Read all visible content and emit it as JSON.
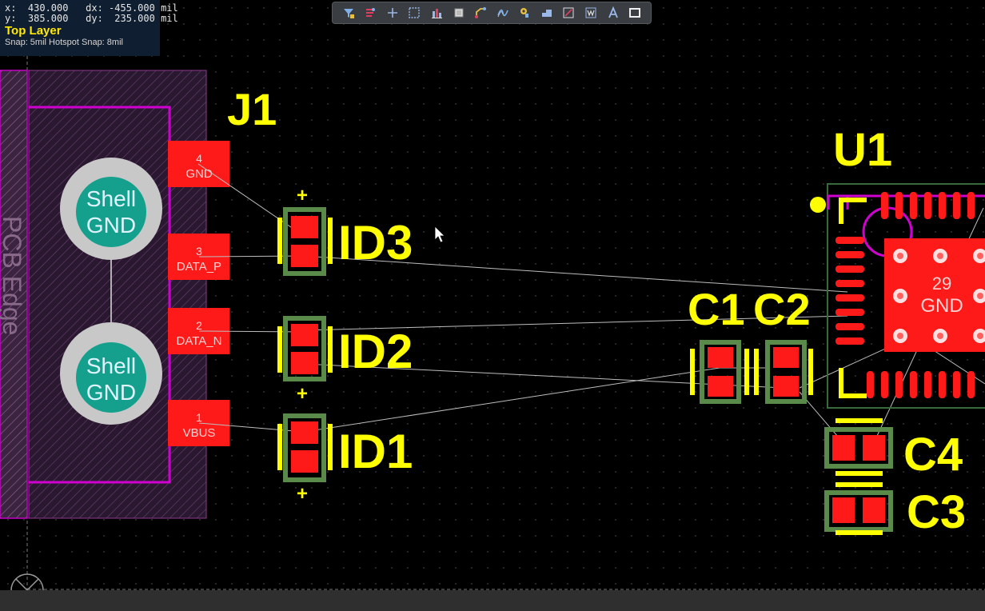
{
  "hud": {
    "line1": "x:  430.000   dx: -455.000 mil",
    "line2": "y:  385.000   dy:  235.000 mil",
    "layer": "Top Layer",
    "snap": "Snap: 5mil Hotspot Snap: 8mil"
  },
  "toolbar": {
    "tools": [
      "filter-icon",
      "route-icon",
      "crosshair-icon",
      "select-rect-icon",
      "align-icon",
      "component-icon",
      "interactive-route-icon",
      "diff-pair-icon",
      "via-icon",
      "polygon-icon",
      "dimension-icon",
      "string-icon",
      "text-icon",
      "rectangle-icon"
    ]
  },
  "board": {
    "edge_label": "PCB Edge",
    "j1": {
      "designator": "J1",
      "shell_top": [
        "Shell",
        "GND"
      ],
      "shell_bottom": [
        "Shell",
        "GND"
      ],
      "pads": [
        {
          "num": "4",
          "net": "GND"
        },
        {
          "num": "3",
          "net": "DATA_P"
        },
        {
          "num": "2",
          "net": "DATA_N"
        },
        {
          "num": "1",
          "net": "VBUS"
        }
      ]
    },
    "diodes": [
      "ID3",
      "ID2",
      "ID1"
    ],
    "caps": [
      "C1",
      "C2",
      "C4",
      "C3"
    ],
    "u1": {
      "designator": "U1",
      "pad_num": "29",
      "pad_net": "GND"
    }
  },
  "colors": {
    "background": "#000000",
    "pad_red": "#ff1a1a",
    "silk_yellow": "#ffff00",
    "outline_magenta": "#c800c8",
    "body_green": "#5a8a4a",
    "shell_teal": "#14a08c",
    "shell_gray": "#c8c8c8"
  }
}
